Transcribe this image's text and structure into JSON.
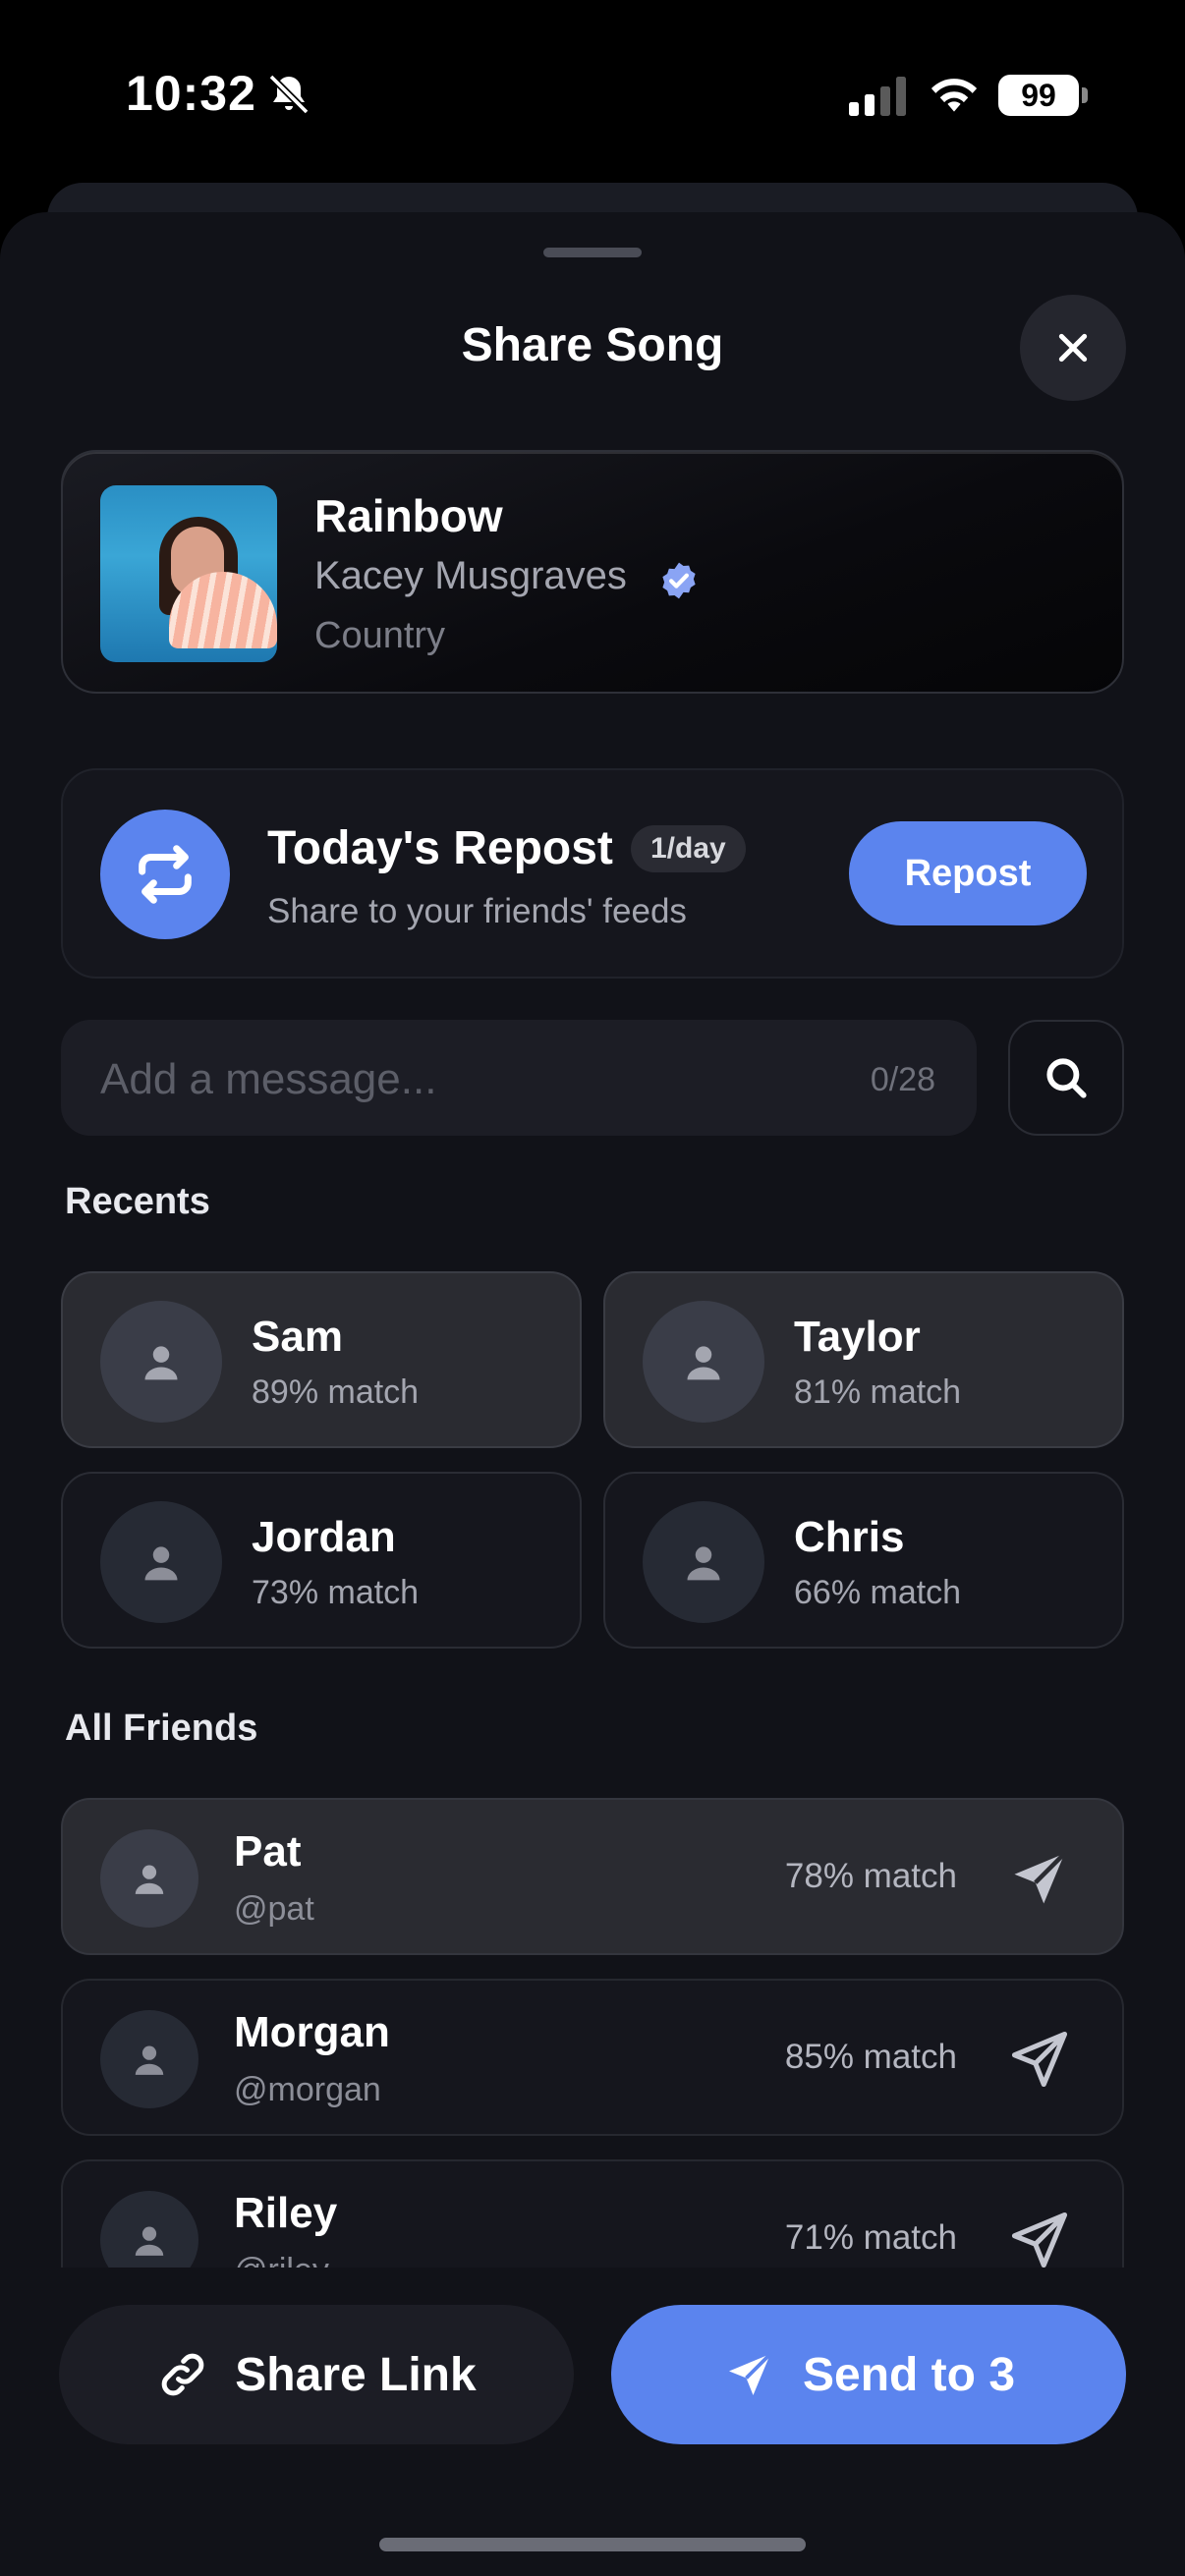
{
  "status_bar": {
    "time": "10:32",
    "battery": "99",
    "icons": [
      "bell-slash-icon",
      "cellular-signal-icon",
      "wifi-icon",
      "battery-icon"
    ]
  },
  "sheet": {
    "title": "Share Song",
    "close_icon": "close-icon"
  },
  "song": {
    "title": "Rainbow",
    "artist": "Kacey Musgraves",
    "genre": "Country",
    "verified_icon": "verified-badge-icon"
  },
  "repost": {
    "title": "Today's Repost",
    "badge": "1/day",
    "subtitle": "Share to your friends' feeds",
    "button_label": "Repost",
    "icon": "repost-icon"
  },
  "message": {
    "placeholder": "Add a message...",
    "count": "0/28",
    "search_icon": "search-icon"
  },
  "recents": {
    "label": "Recents",
    "items": [
      {
        "name": "Sam",
        "match": "89% match"
      },
      {
        "name": "Taylor",
        "match": "81% match"
      },
      {
        "name": "Jordan",
        "match": "73% match"
      },
      {
        "name": "Chris",
        "match": "66% match"
      }
    ]
  },
  "friends": {
    "label": "All Friends",
    "items": [
      {
        "name": "Pat",
        "handle": "@pat",
        "match": "78% match"
      },
      {
        "name": "Morgan",
        "handle": "@morgan",
        "match": "85% match"
      },
      {
        "name": "Riley",
        "handle": "@riley",
        "match": "71% match"
      }
    ]
  },
  "actions": {
    "share_link": "Share Link",
    "send": "Send to 3"
  },
  "colors": {
    "accent": "#5b84ee",
    "background": "#111218",
    "card": "#15161d",
    "selected_card": "#2a2b31"
  }
}
